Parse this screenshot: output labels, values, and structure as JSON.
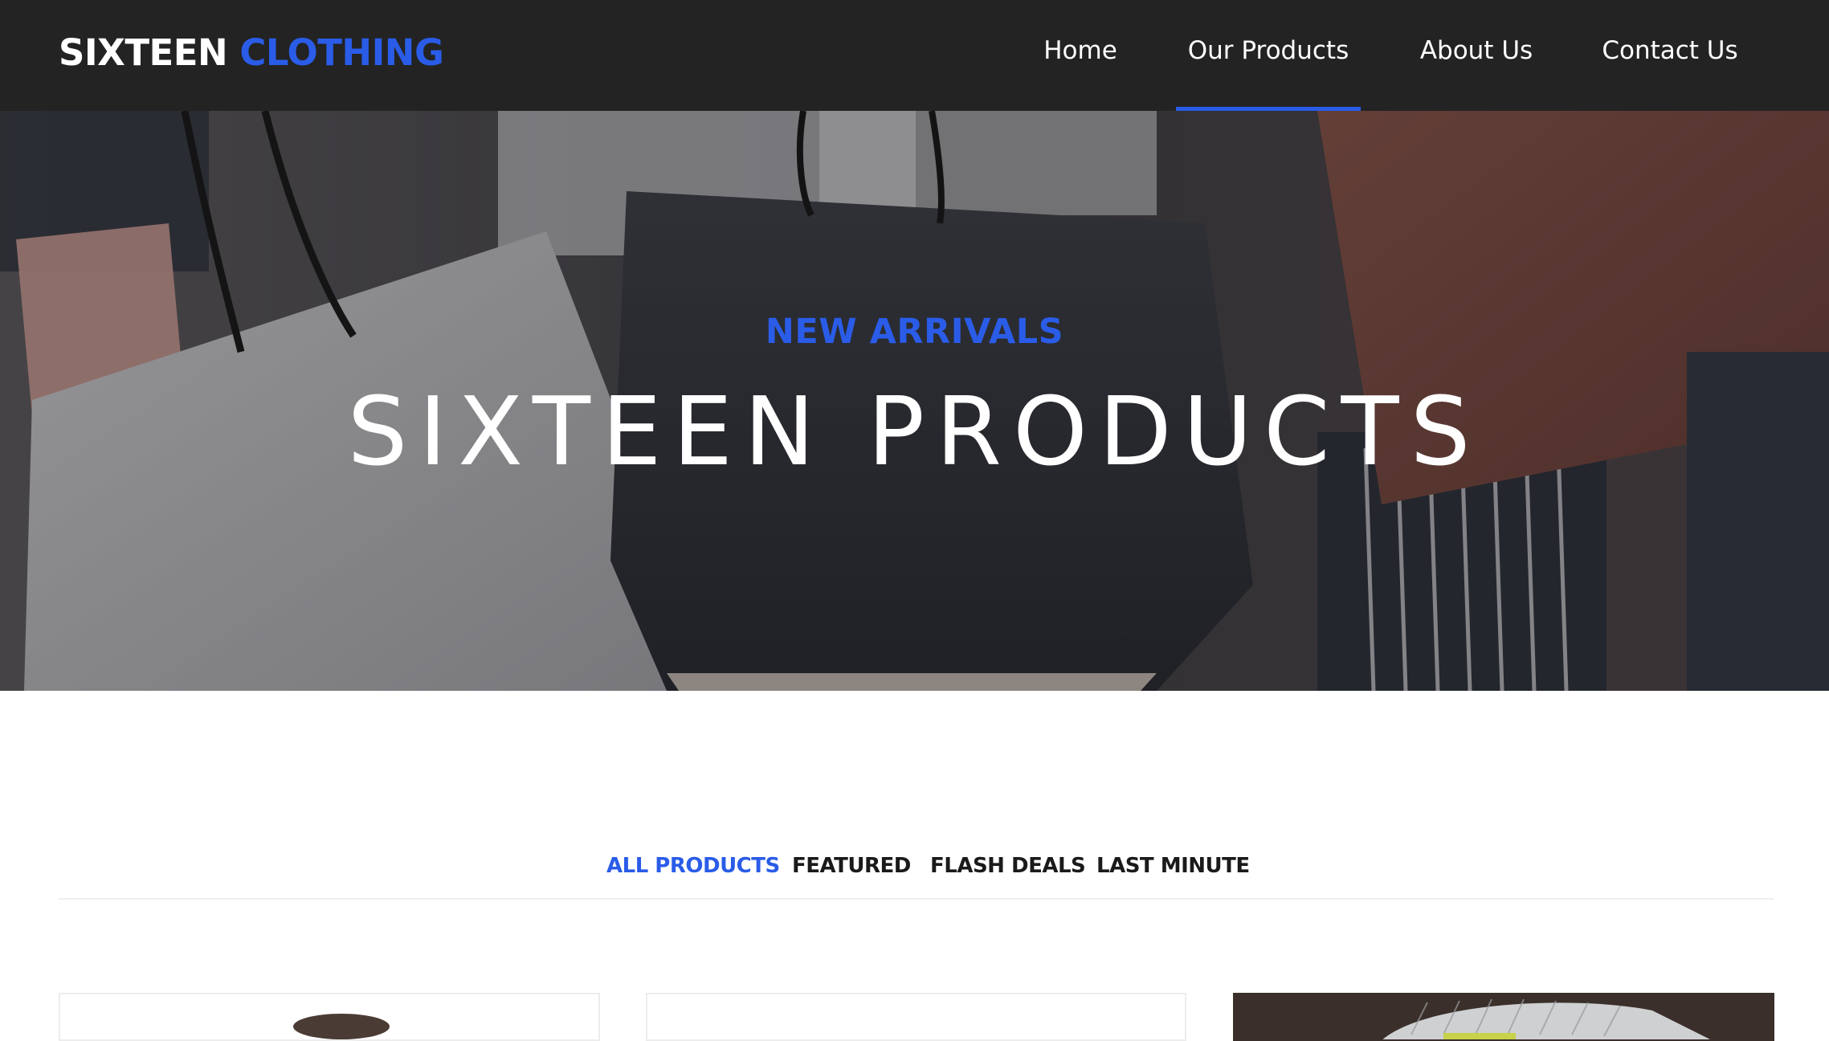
{
  "header": {
    "logo_main": "SIXTEEN",
    "logo_accent": "CLOTHING",
    "nav": [
      {
        "label": "Home",
        "active": false
      },
      {
        "label": "Our Products",
        "active": true
      },
      {
        "label": "About Us",
        "active": false
      },
      {
        "label": "Contact Us",
        "active": false
      }
    ]
  },
  "hero": {
    "kicker": "NEW ARRIVALS",
    "title": "SIXTEEN PRODUCTS"
  },
  "filters": {
    "tabs": [
      {
        "label": "ALL PRODUCTS",
        "active": true
      },
      {
        "label": "FEATURED",
        "active": false
      },
      {
        "label": "FLASH DEALS",
        "active": false
      },
      {
        "label": "LAST MINUTE",
        "active": false
      }
    ]
  },
  "colors": {
    "accent": "#2a5ce8",
    "header_bg": "#232323",
    "text_dark": "#1a1a1a"
  }
}
